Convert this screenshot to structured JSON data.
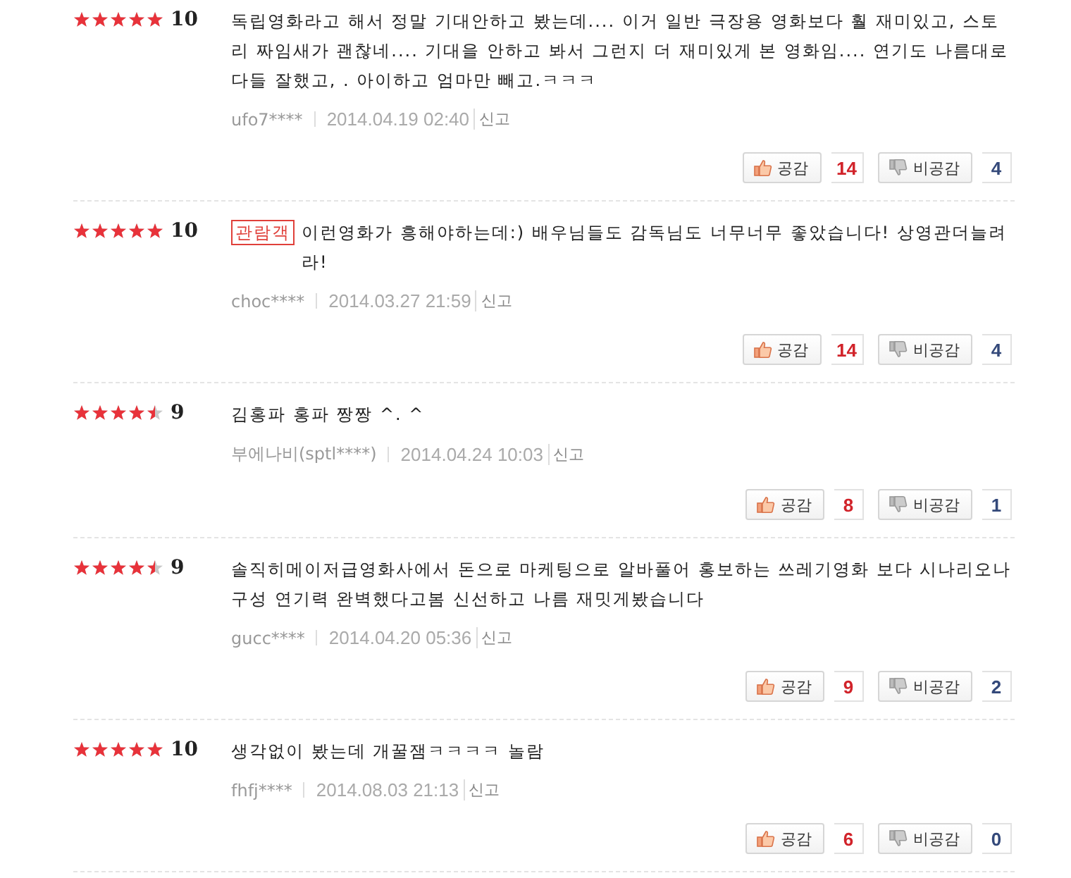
{
  "reviews": [
    {
      "stars": 5,
      "score": "10",
      "text": "독립영화라고 해서 정말 기대안하고 봤는데.... 이거 일반 극장용 영화보다 훨 재미있고, 스토리 짜임새가 괜찮네.... 기대을 안하고 봐서 그런지 더 재미있게 본 영화임.... 연기도 나름대로 다들 잘했고, . 아이하고 엄마만 빼고.ㅋㅋㅋ",
      "author": "ufo7****",
      "date": "2014.04.19 02:40",
      "report": "신고",
      "like_label": "공감",
      "likes": "14",
      "dislike_label": "비공감",
      "dislikes": "4"
    },
    {
      "stars": 5,
      "score": "10",
      "badge": "관람객",
      "text": "이런영화가 흥해야하는데:) 배우님들도 감독님도 너무너무 좋았습니다! 상영관더늘려라!",
      "author": "choc****",
      "date": "2014.03.27 21:59",
      "report": "신고",
      "like_label": "공감",
      "likes": "14",
      "dislike_label": "비공감",
      "dislikes": "4"
    },
    {
      "stars": 4.5,
      "score": "9",
      "text": "김홍파 홍파 짱짱 ^. ^",
      "author": "부에나비(sptl****)",
      "date": "2014.04.24 10:03",
      "report": "신고",
      "like_label": "공감",
      "likes": "8",
      "dislike_label": "비공감",
      "dislikes": "1"
    },
    {
      "stars": 4.5,
      "score": "9",
      "text": "솔직히메이저급영화사에서 돈으로 마케팅으로 알바풀어 홍보하는 쓰레기영화 보다 시나리오나 구성 연기력 완벽했다고봄 신선하고 나름 재밋게봤습니다",
      "author": "gucc****",
      "date": "2014.04.20 05:36",
      "report": "신고",
      "like_label": "공감",
      "likes": "9",
      "dislike_label": "비공감",
      "dislikes": "2"
    },
    {
      "stars": 5,
      "score": "10",
      "text": "생각없이 봤는데 개꿀잼ㅋㅋㅋㅋ 놀람",
      "author": "fhfj****",
      "date": "2014.08.03 21:13",
      "report": "신고",
      "like_label": "공감",
      "likes": "6",
      "dislike_label": "비공감",
      "dislikes": "0"
    }
  ]
}
